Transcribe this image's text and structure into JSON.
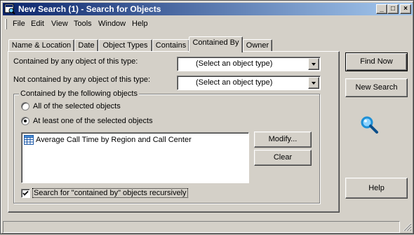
{
  "window": {
    "title": "New Search (1) - Search for Objects",
    "minimize": "_",
    "maximize": "□",
    "close": "×"
  },
  "menu": [
    "File",
    "Edit",
    "View",
    "Tools",
    "Window",
    "Help"
  ],
  "tabs": [
    "Name & Location",
    "Date",
    "Object Types",
    "Contains",
    "Contained By",
    "Owner"
  ],
  "active_tab": "Contained By",
  "form": {
    "contained_label": "Contained by any object of this type:",
    "contained_value": "(Select an object type)",
    "not_contained_label": "Not contained by any object of this type:",
    "not_contained_value": "(Select an object type)",
    "group_title": "Contained by the following objects",
    "radio_all": "All of the selected objects",
    "radio_atleast": "At least one of the selected objects",
    "radio_selected": "At least one of the selected objects",
    "list_items": [
      "Average Call Time by Region and Call Center"
    ],
    "modify_button": "Modify...",
    "clear_button": "Clear",
    "recursive_label": "Search for \"contained by\" objects recursively",
    "recursive_checked": true
  },
  "side_buttons": {
    "find_now": "Find Now",
    "new_search": "New Search",
    "help": "Help"
  },
  "icons": {
    "title": "search-window-icon",
    "search": "magnifier-icon",
    "list_item": "report-grid-icon"
  },
  "colors": {
    "titlebar_start": "#0a246a",
    "titlebar_end": "#a6caf0",
    "face": "#d4d0c8",
    "magnifier": "#1e90d6"
  }
}
